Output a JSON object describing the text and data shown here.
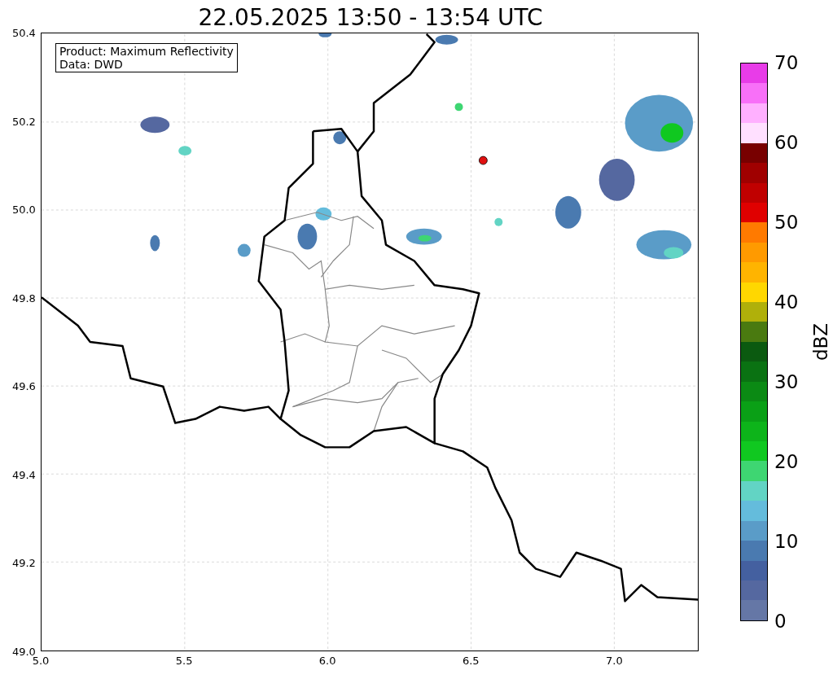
{
  "title": "22.05.2025 13:50 - 13:54 UTC",
  "map": {
    "legend": [
      "Product: Maximum Reflectivity",
      "Data: DWD"
    ],
    "xticks": [
      "5.0",
      "5.5",
      "6.0",
      "6.5",
      "7.0"
    ],
    "yticks": [
      "50.4",
      "50.2",
      "50.0",
      "49.8",
      "49.6",
      "49.4",
      "49.2",
      "49.0"
    ]
  },
  "colorbar": {
    "label": "dBZ",
    "ticks": [
      "70",
      "60",
      "50",
      "40",
      "30",
      "20",
      "10",
      "0"
    ],
    "bands": [
      {
        "color": "#e83ce8"
      },
      {
        "color": "#f870f8"
      },
      {
        "color": "#ffb0ff"
      },
      {
        "color": "#ffe0ff"
      },
      {
        "color": "#780000"
      },
      {
        "color": "#a00000"
      },
      {
        "color": "#c00000"
      },
      {
        "color": "#e00000"
      },
      {
        "color": "#ff7a00"
      },
      {
        "color": "#ff9a00"
      },
      {
        "color": "#ffb400"
      },
      {
        "color": "#ffd700"
      },
      {
        "color": "#b0b00a"
      },
      {
        "color": "#4a7a10"
      },
      {
        "color": "#0b5a10"
      },
      {
        "color": "#0a7212"
      },
      {
        "color": "#0b8a14"
      },
      {
        "color": "#0aa016"
      },
      {
        "color": "#0db41a"
      },
      {
        "color": "#10c820"
      },
      {
        "color": "#3ed672"
      },
      {
        "color": "#62d4c4"
      },
      {
        "color": "#64bcdc"
      },
      {
        "color": "#5a9cc8"
      },
      {
        "color": "#4a7ab0"
      },
      {
        "color": "#4460a0"
      },
      {
        "color": "#5568a0"
      },
      {
        "color": "#6577a6"
      }
    ]
  }
}
